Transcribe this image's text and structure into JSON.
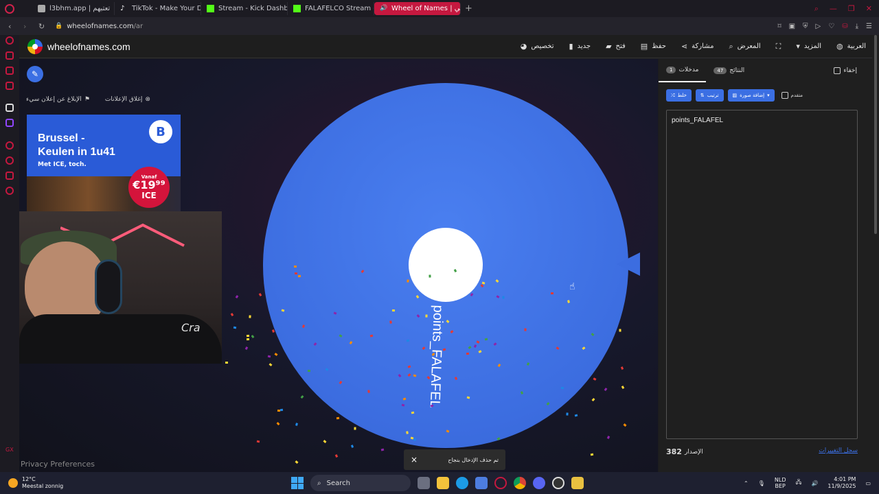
{
  "browser": {
    "tabs": [
      {
        "label": "l3bhm.app | تعتبهم"
      },
      {
        "label": "TikTok - Make Your Day"
      },
      {
        "label": "Stream - Kick Dashboard"
      },
      {
        "label": "FALAFELCO Stream - Wat"
      },
      {
        "label": "Wheel of Names | الي"
      }
    ],
    "new_tab": "+",
    "url_host": "wheelofnames.com",
    "url_path": "/ar"
  },
  "site": {
    "title": "wheelofnames.com",
    "menu": {
      "customize": "تخصيص",
      "new": "جديد",
      "open": "فتح",
      "save": "حفظ",
      "share": "مشاركة",
      "gallery": "المعرض",
      "more": "المزيد",
      "language": "العربية"
    }
  },
  "ads": {
    "report_ad": "الإبلاغ عن إعلان سيء",
    "close_ads": "إغلاق الإعلانات",
    "headline": "Brussel -\nKeulen in 1u41",
    "sub": "Met ICE, toch.",
    "brand_letter": "B",
    "price_prefix": "Vanaf",
    "price": "€19⁹⁹",
    "price_suffix": "ICE"
  },
  "webcam": {
    "shirt_text": "Cra"
  },
  "wheel": {
    "segment_label": "points_FALAFEL",
    "color": "#3c6de0"
  },
  "toast": {
    "message": "تم حذف الإدخال بنجاح",
    "close": "×"
  },
  "privacy": "Privacy Preferences",
  "panel": {
    "tab_entries": "مدخلات",
    "entries_count": "1",
    "tab_results": "النتائج",
    "results_count": "47",
    "hide_label": "إخفاء",
    "shuffle_label": "خلط",
    "sort_label": "ترتيب",
    "add_image_label": "إضافة صورة",
    "advanced_label": "متقدم",
    "entries": [
      "points_FALAFEL"
    ],
    "version_label": "الإصدار",
    "version": "382",
    "changelog": "سجل التغييرات"
  },
  "taskbar": {
    "temperature": "12°C",
    "weather": "Meestal zonnig",
    "search": "Search",
    "lang_top": "NLD",
    "lang_bottom": "BEP",
    "time": "4:01 PM",
    "date": "11/9/2025"
  },
  "sidebar_bottom": "GX"
}
